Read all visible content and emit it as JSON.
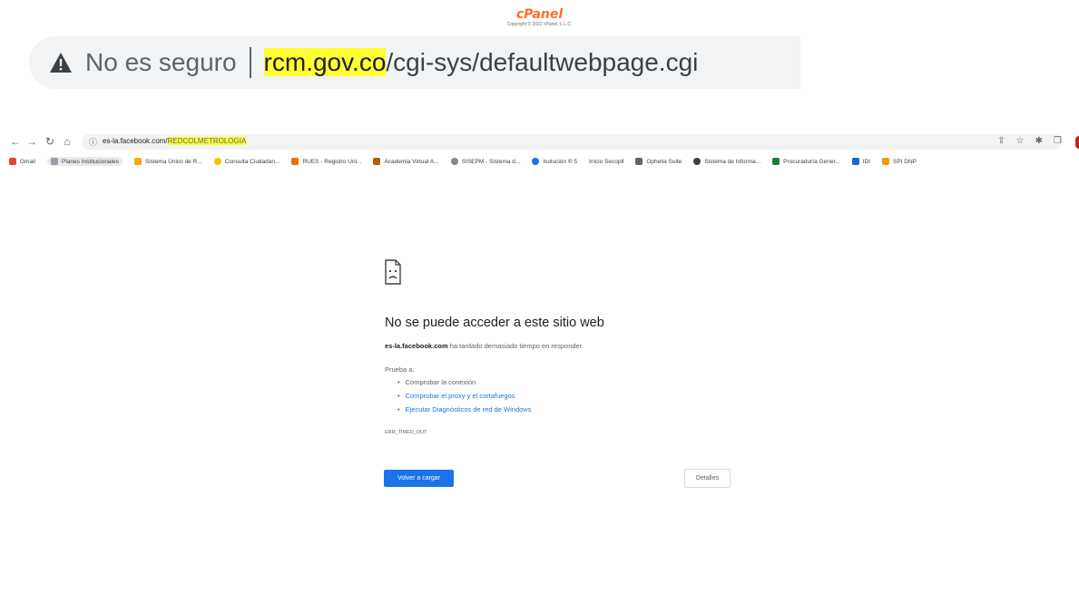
{
  "cpanel": {
    "logo": "cPanel",
    "copyright": "Copyright © 2022 cPanel, L.L.C."
  },
  "zoomed_address_bar": {
    "warning_icon": "warning-triangle-icon",
    "security_text": "No es seguro",
    "url_highlight": "rcm.gov.co",
    "url_rest": "/cgi-sys/defaultwebpage.cgi",
    "highlight_color": "#ffff33"
  },
  "browser": {
    "nav_icons": [
      "back-arrow-icon",
      "forward-arrow-icon",
      "reload-icon",
      "home-icon"
    ],
    "info_icon": "ⓘ",
    "url_host": "es-la.facebook.com/",
    "url_path": "REDCOLMETROLOGIA",
    "toolbar_icons": [
      "share-icon",
      "star-icon",
      "extensions-icon",
      "sidebar-icon"
    ]
  },
  "bookmarks": [
    {
      "label": "Gmail",
      "color": "#ea4335"
    },
    {
      "label": "Planes Institucionales",
      "color": "#9aa0a6"
    },
    {
      "label": "Sistema Único de R...",
      "color": "#f9ab00"
    },
    {
      "label": "Consulta Ciudadan...",
      "color": "#fbbc04"
    },
    {
      "label": "RUES - Registro Uni...",
      "color": "#e37400"
    },
    {
      "label": "Academia Virtual A...",
      "color": "#b06000"
    },
    {
      "label": "SISEPM - Sistema d...",
      "color": "#80868b"
    },
    {
      "label": "Isolución ® 5",
      "color": "#1a73e8"
    },
    {
      "label": "Inicio Secopll",
      "color": "#ffffff"
    },
    {
      "label": "Ophelia Suite",
      "color": "#5f6368"
    },
    {
      "label": "Sistema de Informa...",
      "color": "#3c4043"
    },
    {
      "label": "Procuraduría Gener...",
      "color": "#188038"
    },
    {
      "label": "IDI",
      "color": "#1967d2"
    },
    {
      "label": "SPI DNP",
      "color": "#f29900"
    }
  ],
  "error_page": {
    "icon": "sad-page-icon",
    "title": "No se puede acceder a este sitio web",
    "host": "es-la.facebook.com",
    "message": " ha tardado demasiado tiempo en responder.",
    "try_label": "Prueba a:",
    "suggestions": [
      "Comprobar la conexión",
      "Comprobar el proxy y el cortafuegos",
      "Ejecutar Diagnósticos de red de Windows"
    ],
    "error_code": "ERR_TIMED_OUT",
    "reload_button": "Volver a cargar",
    "details_button": "Detalles"
  }
}
